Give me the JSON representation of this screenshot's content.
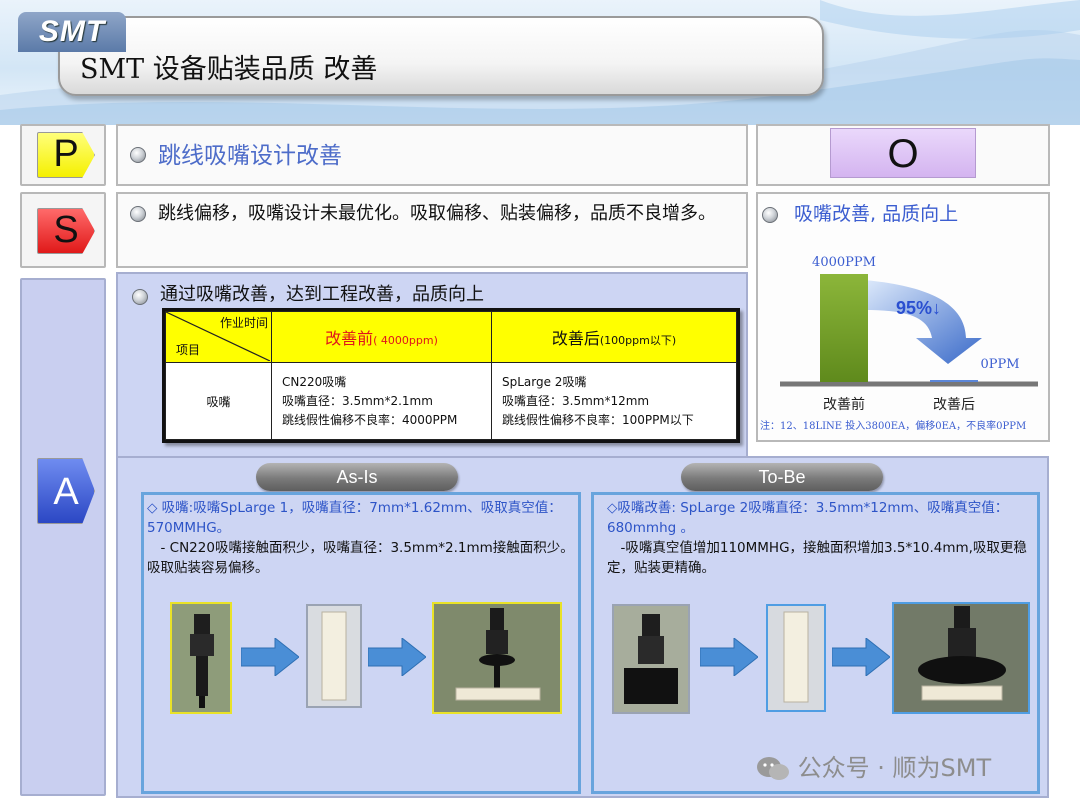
{
  "header": {
    "logo": "SMT",
    "title": "SMT 设备贴装品质 改善"
  },
  "labels": {
    "p": "P",
    "s": "S",
    "a": "A",
    "o": "O"
  },
  "colors": {
    "p_tile": "#ffff44",
    "s_tile": "#ee3b3b",
    "a_tile": "#3e5fd6",
    "o_tile": "#d9b8f2",
    "accent_blue": "#4d6cc9"
  },
  "p_section": {
    "heading": "跳线吸嘴设计改善"
  },
  "s_section": {
    "text": "跳线偏移，吸嘴设计未最优化。吸取偏移、贴装偏移，品质不良增多。"
  },
  "a_section": {
    "heading": "通过吸嘴改善，达到工程改善，品质向上",
    "table": {
      "corner_top": "作业时间",
      "corner_bottom": "项目",
      "col1_label": "改善前",
      "col1_note": "( 4000ppm)",
      "col2_label": "改善后",
      "col2_note": "(100ppm以下)",
      "row_label": "吸嘴",
      "before_lines": [
        "CN220吸嘴",
        "吸嘴直径：3.5mm*2.1mm",
        "跳线假性偏移不良率：4000PPM"
      ],
      "after_lines": [
        "SpLarge 2吸嘴",
        "吸嘴直径：3.5mm*12mm",
        "跳线假性偏移不良率：100PPM以下"
      ]
    },
    "as_is": {
      "pill": "As-Is",
      "line1": "◇ 吸嘴:吸嘴SpLarge 1，吸嘴直径：7mm*1.62mm、吸取真空值：570MMHG。",
      "line2": "　- CN220吸嘴接触面积少，吸嘴直径：3.5mm*2.1mm接触面积少。　　吸取贴装容易偏移。"
    },
    "to_be": {
      "pill": "To-Be",
      "line1": "◇吸嘴改善: SpLarge 2吸嘴直径：3.5mm*12mm、吸嘴真空值：680mmhg 。",
      "line2": "　-吸嘴真空值增加110MMHG，接触面积增加3.5*10.4mm,吸取更稳定，贴装更精确。"
    }
  },
  "o_section": {
    "heading": "吸嘴改善, 品质向上",
    "chart_data": {
      "type": "bar",
      "categories": [
        "改善前",
        "改善后"
      ],
      "values": [
        4000,
        0
      ],
      "value_labels": [
        "4000PPM",
        "0PPM"
      ],
      "annotation": "95%↓"
    },
    "note": "注：12、18LINE 投入3800EA，偏移0EA，不良率0PPM"
  },
  "watermark": "公众号 · 顺为SMT"
}
